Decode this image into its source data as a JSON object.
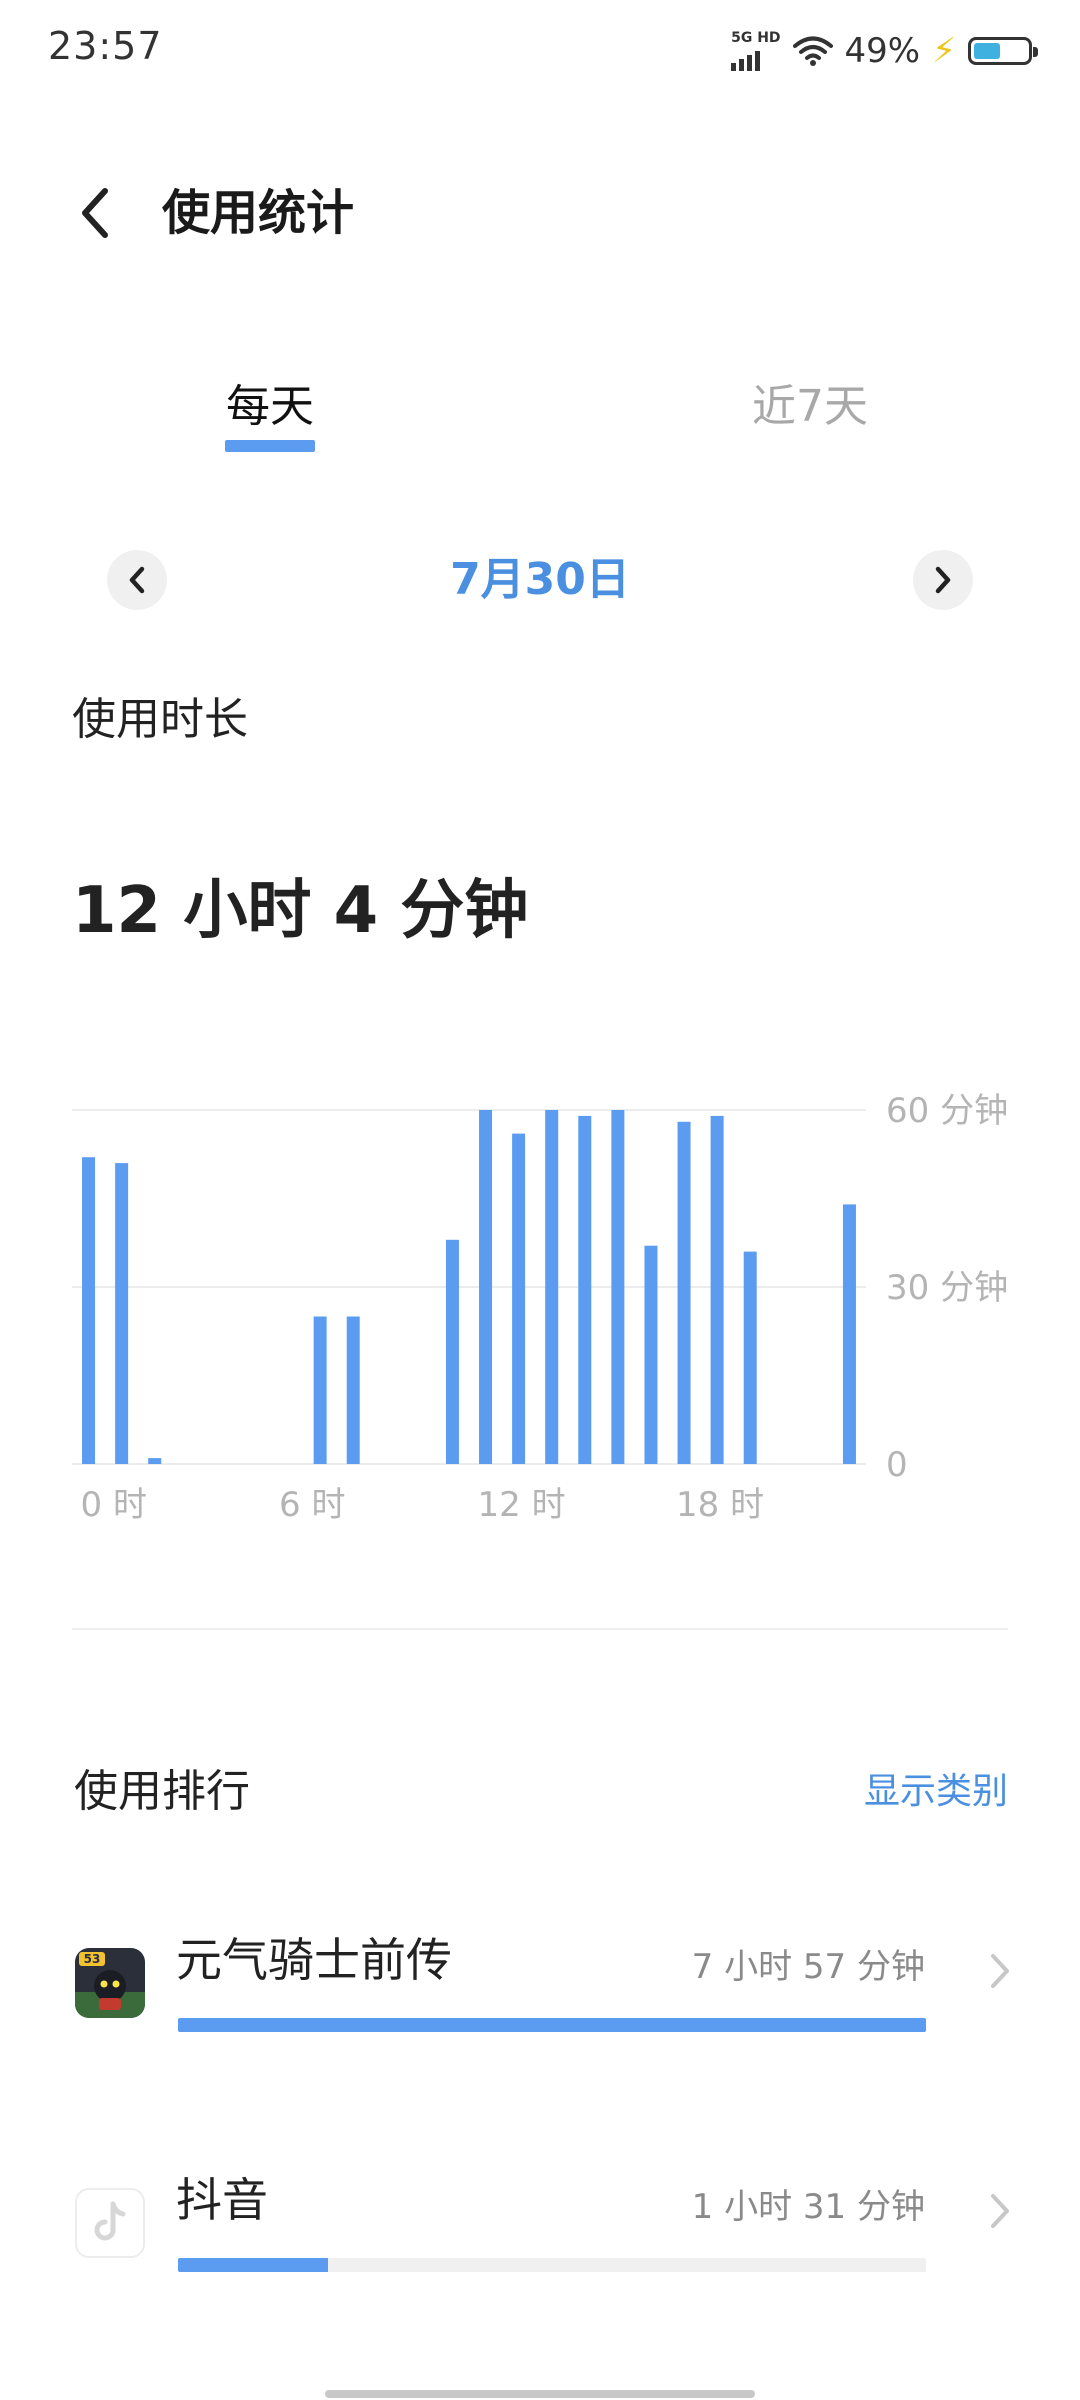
{
  "status_bar": {
    "time": "23:57",
    "network": "5G HD",
    "battery_percent": "49%",
    "battery_level": 0.49
  },
  "header": {
    "title": "使用统计",
    "back_icon": "chevron-left-icon"
  },
  "tabs": [
    {
      "label": "每天",
      "selected": true
    },
    {
      "label": "近7天",
      "selected": false
    }
  ],
  "date_nav": {
    "date": "7月30日",
    "prev_icon": "chevron-left-icon",
    "next_icon": "chevron-right-icon"
  },
  "usage": {
    "section_label": "使用时长",
    "total": "12 小时 4 分钟"
  },
  "chart_data": {
    "type": "bar",
    "x": [
      0,
      1,
      2,
      3,
      4,
      5,
      6,
      7,
      8,
      9,
      10,
      11,
      12,
      13,
      14,
      15,
      16,
      17,
      18,
      19,
      20,
      21,
      22,
      23
    ],
    "values": [
      52,
      51,
      1,
      0,
      0,
      0,
      0,
      25,
      25,
      0,
      0,
      38,
      60,
      56,
      60,
      59,
      60,
      37,
      58,
      59,
      36,
      0,
      0,
      44
    ],
    "ylim": [
      0,
      60
    ],
    "y_ticks": [
      "0",
      "30 分钟",
      "60 分钟"
    ],
    "x_ticks": [
      "0 时",
      "6 时",
      "12 时",
      "18 时"
    ],
    "bar_color": "#5b9cf0",
    "grid": true
  },
  "ranking": {
    "title": "使用排行",
    "action": "显示类别",
    "apps": [
      {
        "name": "元气骑士前传",
        "time": "7 小时 57 分钟",
        "fraction": 1.0,
        "icon": "soul-knight-prequel-app-icon"
      },
      {
        "name": "抖音",
        "time": "1 小时 31 分钟",
        "fraction": 0.2,
        "icon": "douyin-app-icon"
      }
    ]
  },
  "colors": {
    "accent": "#5b9cf0",
    "accent_text": "#4a8fe0",
    "muted": "#a8a8a8"
  }
}
